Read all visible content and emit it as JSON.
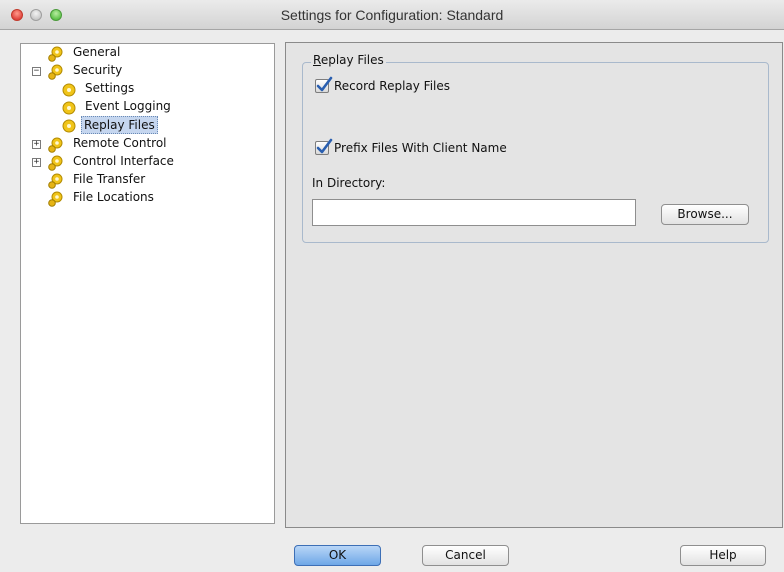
{
  "window": {
    "title": "Settings for Configuration: Standard"
  },
  "tree": {
    "items": [
      {
        "label": "General",
        "level": 0,
        "expander": "",
        "icon": "gear-icon"
      },
      {
        "label": "Security",
        "level": 0,
        "expander": "−",
        "icon": "gear-icon"
      },
      {
        "label": "Settings",
        "level": 1,
        "expander": "",
        "icon": "gear-icon"
      },
      {
        "label": "Event Logging",
        "level": 1,
        "expander": "",
        "icon": "gear-icon"
      },
      {
        "label": "Replay Files",
        "level": 1,
        "expander": "",
        "icon": "gear-icon",
        "selected": true
      },
      {
        "label": "Remote Control",
        "level": 0,
        "expander": "+",
        "icon": "gear-icon"
      },
      {
        "label": "Control Interface",
        "level": 0,
        "expander": "+",
        "icon": "gear-icon"
      },
      {
        "label": "File Transfer",
        "level": 0,
        "expander": "",
        "icon": "gear-icon"
      },
      {
        "label": "File Locations",
        "level": 0,
        "expander": "",
        "icon": "gear-icon"
      }
    ]
  },
  "replay": {
    "group_title_first": "R",
    "group_title_rest": "eplay Files",
    "record": {
      "label": "Record Replay Files",
      "checked": true
    },
    "prefix": {
      "label": "Prefix Files With Client Name",
      "checked": true
    },
    "directory_label": "In Directory:",
    "directory_value": "",
    "browse_label": "Browse..."
  },
  "buttons": {
    "ok": "OK",
    "cancel": "Cancel",
    "help": "Help"
  },
  "colors": {
    "selection": "#c5d6ef",
    "gear": "#f0c419",
    "check": "#2a5fb0",
    "ok_button": "#6ea7e7"
  }
}
